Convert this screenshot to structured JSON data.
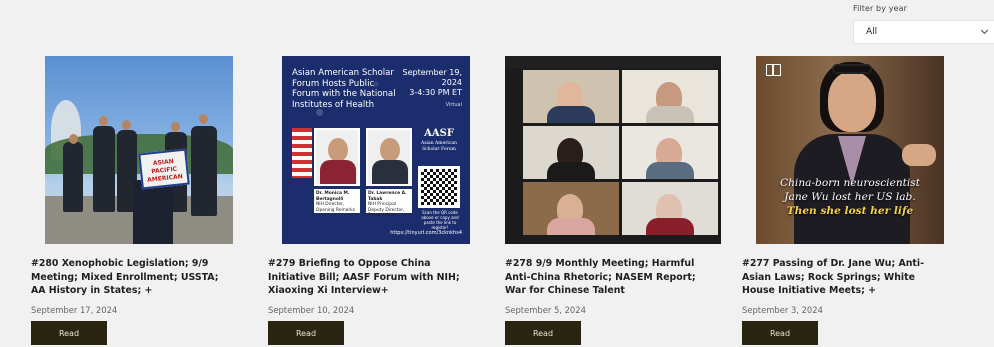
{
  "filter": {
    "label": "Filter by year",
    "selected": "All"
  },
  "read_label": "Read",
  "cards": [
    {
      "title": "#280 Xenophobic Legislation; 9/9 Meeting; Mixed Enrollment; USSTA; AA History in States; +",
      "date": "September 17, 2024",
      "image_sign": "ASIAN PACIFIC AMERICAN"
    },
    {
      "title": "#279 Briefing to Oppose China Initiative Bill; AASF Forum with NIH; Xiaoxing Xi Interview+",
      "date": "September 10, 2024",
      "image": {
        "heading": "Asian American Scholar Forum Hosts Public Forum with the National Institutes of Health",
        "date": "September 19, 2024",
        "time": "3-4:30 PM ET",
        "mode": "Virtual",
        "speaker1": "Dr. Monica M. Bertagnolli",
        "speaker1_role": "NIH Director, Opening Remarks",
        "speaker2": "Dr. Lawrence A. Tabak",
        "speaker2_role": "NIH Principal Deputy Director, Presentation",
        "logo": "AASF",
        "logo_sub": "Asian American Scholar Forum",
        "scan_text": "Scan the QR code above or copy and paste the link to register!",
        "url": "https://tinyurl.com/3cknkhs4"
      }
    },
    {
      "title": "#278 9/9 Monthly Meeting; Harmful Anti-China Rhetoric; NASEM Report; War for Chinese Talent",
      "date": "September 5, 2024"
    },
    {
      "title": "#277 Passing of Dr. Jane Wu; Anti-Asian Laws; Rock Springs; White House Initiative Meets; +",
      "date": "September 3, 2024",
      "image": {
        "line1": "China-born neuroscientist",
        "line2": "Jane Wu lost her US lab.",
        "line3": "Then she lost her life"
      }
    }
  ]
}
